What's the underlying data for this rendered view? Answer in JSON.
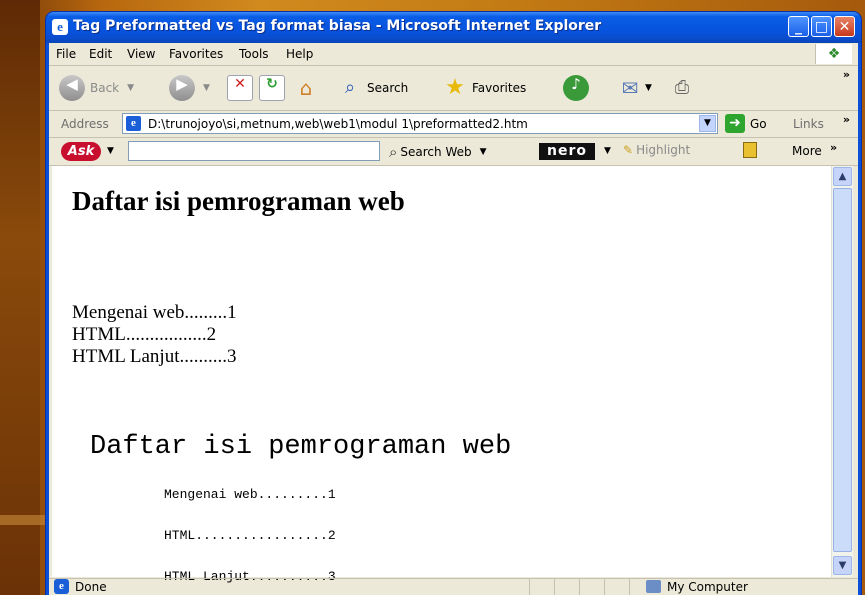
{
  "window": {
    "title": "Tag Preformatted vs Tag format biasa - Microsoft Internet Explorer",
    "caption_buttons": {
      "minimize": "_",
      "maximize": "□",
      "close": "✕"
    }
  },
  "menu": [
    "File",
    "Edit",
    "View",
    "Favorites",
    "Tools",
    "Help"
  ],
  "toolbar": {
    "back": "Back",
    "search": "Search",
    "favorites": "Favorites"
  },
  "address": {
    "label": "Address",
    "url": "D:\\trunojoyo\\si,metnum,web\\web1\\modul 1\\preformatted2.htm",
    "go": "Go",
    "links": "Links"
  },
  "askbar": {
    "logo": "Ask",
    "search_web": "Search Web",
    "nero": "nero",
    "highlight": "Highlight",
    "more": "More"
  },
  "page": {
    "heading": "Daftar isi pemrograman web",
    "lines": [
      "Mengenai web.........1",
      "HTML.................2",
      "HTML Lanjut..........3"
    ],
    "pre_heading": "Daftar isi pemrograman web",
    "pre_lines": [
      "Mengenai web.........1",
      "HTML.................2",
      "HTML Lanjut..........3"
    ]
  },
  "status": {
    "text": "Done",
    "zone": "My Computer"
  },
  "icons": [
    "ie-icon",
    "back-arrow-icon",
    "forward-arrow-icon",
    "stop-icon",
    "refresh-icon",
    "home-icon",
    "search-icon",
    "favorites-star-icon",
    "media-icon",
    "mail-icon",
    "print-icon",
    "go-arrow-icon",
    "highlighter-icon",
    "computer-icon"
  ]
}
